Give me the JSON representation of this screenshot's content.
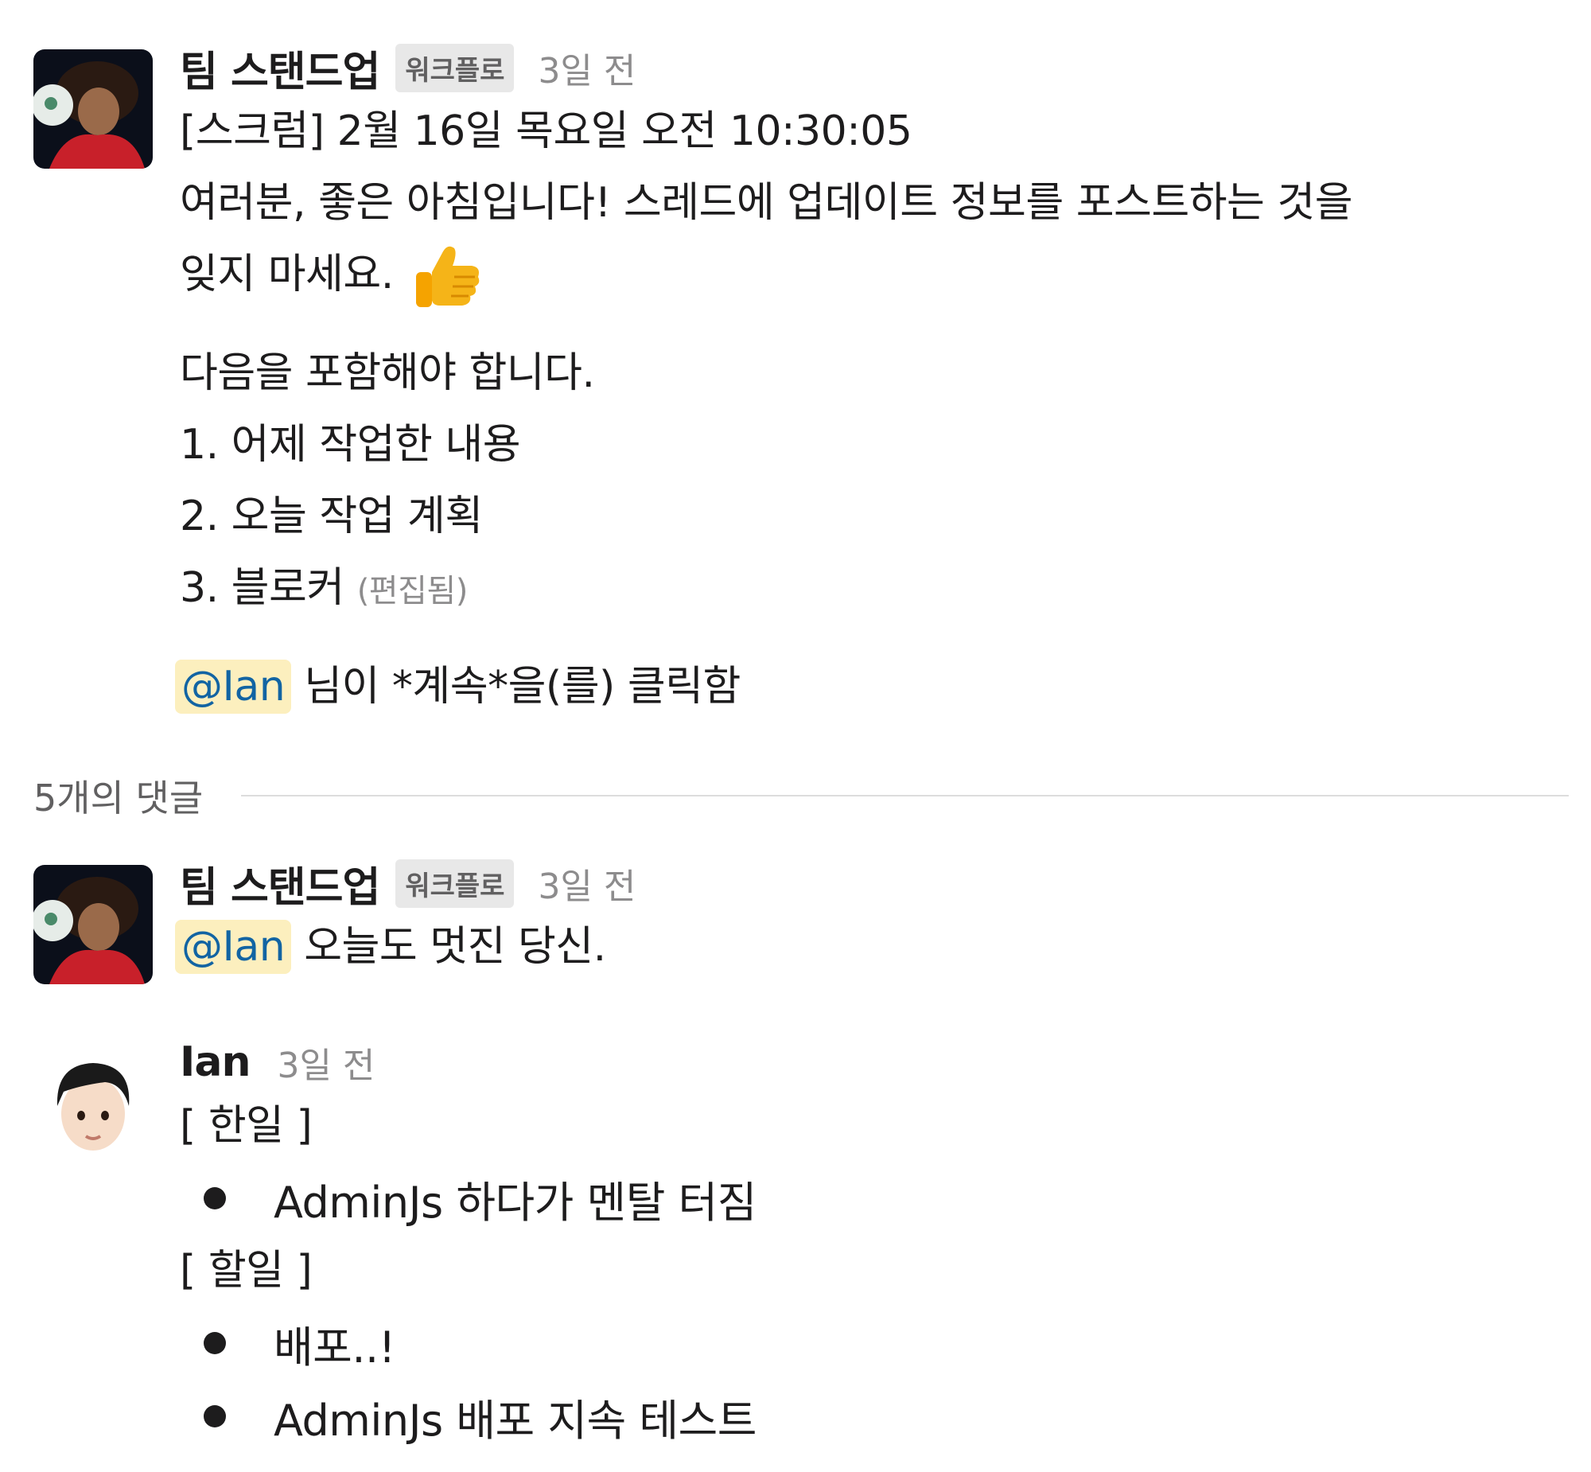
{
  "thread": {
    "parent": {
      "sender": "팀 스탠드업",
      "badge": "워크플로",
      "time": "3일 전",
      "lines": [
        "[스크럼]  2월 16일 목요일 오전 10:30:05",
        "여러분, 좋은 아침입니다! 스레드에 업데이트 정보를 포스트하는 것을",
        "잊지 마세요."
      ],
      "emoji": "thumbs-up",
      "list_intro": "다음을 포함해야 합니다.",
      "list_items": [
        "1. 어제 작업한 내용",
        "2. 오늘 작업 계획",
        "3. 블로커"
      ],
      "edited": "(편집됨)",
      "mention": "@Ian",
      "mention_suffix": "님이 *계속*을(를) 클릭함"
    },
    "replies_label": "5개의 댓글",
    "reply1": {
      "sender": "팀 스탠드업",
      "badge": "워크플로",
      "time": "3일 전",
      "mention": "@Ian",
      "text": "오늘도 멋진 당신."
    },
    "reply2": {
      "sender": "Ian",
      "time": "3일 전",
      "done_header": "[ 한일 ]",
      "done_items": [
        "AdminJs 하다가 멘탈 터짐"
      ],
      "todo_header": "[ 할일 ]",
      "todo_items": [
        "배포..!",
        "AdminJs 배포 지속 테스트"
      ]
    }
  }
}
